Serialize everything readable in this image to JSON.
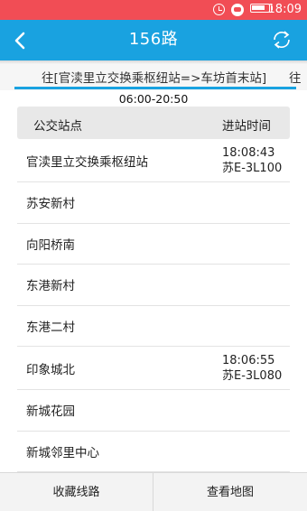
{
  "status_bar": {
    "time": "18:09"
  },
  "header": {
    "title": "156路"
  },
  "direction": {
    "current": "往[官渎里立交换乘枢纽站=>车坊首末站]",
    "next_partial": "往"
  },
  "service_hours": "06:00-20:50",
  "table": {
    "col_stop": "公交站点",
    "col_arrival": "进站时间",
    "rows": [
      {
        "stop": "官渎里立交换乘枢纽站",
        "time": "18:08:43",
        "plate": "苏E-3L100"
      },
      {
        "stop": "苏安新村"
      },
      {
        "stop": "向阳桥南"
      },
      {
        "stop": "东港新村"
      },
      {
        "stop": "东港二村"
      },
      {
        "stop": "印象城北",
        "time": "18:06:55",
        "plate": "苏E-3L080"
      },
      {
        "stop": "新城花园"
      },
      {
        "stop": "新城邻里中心"
      }
    ]
  },
  "bottom_bar": {
    "favorite_label": "收藏线路",
    "map_label": "查看地图"
  },
  "colors": {
    "status_bar": "#f14d55",
    "header": "#19a2e0",
    "accent": "#19a2e0"
  },
  "icons": [
    "alarm-icon",
    "app-notification-icon",
    "battery-icon",
    "back-arrow-icon",
    "refresh-icon"
  ]
}
